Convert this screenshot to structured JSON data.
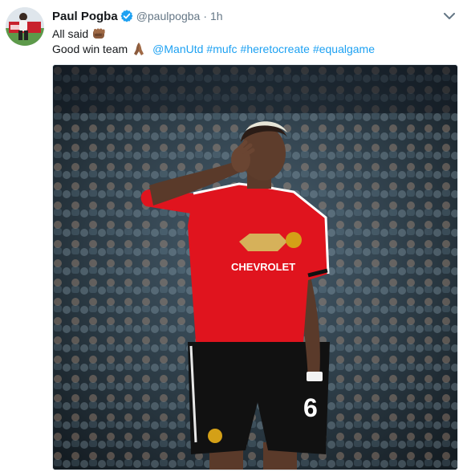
{
  "tweet": {
    "author_name": "Paul Pogba",
    "handle": "@paulpogba",
    "separator": "·",
    "time": "1h",
    "line1_text": "All said",
    "line1_emoji": "fist-emoji",
    "line2_text": "Good win team",
    "line2_emoji": "praying-hands-emoji",
    "mentions": [
      "@ManUtd"
    ],
    "hashtags": [
      "#mufc",
      "#heretocreate",
      "#equalgame"
    ],
    "jersey_number": "6",
    "sponsor": "CHEVROLET"
  },
  "colors": {
    "link": "#1da1f2",
    "verified": "#1da1f2",
    "muted": "#657786",
    "shirt": "#e0141e"
  },
  "icons": [
    "verified-badge-icon",
    "chevron-down-icon"
  ]
}
